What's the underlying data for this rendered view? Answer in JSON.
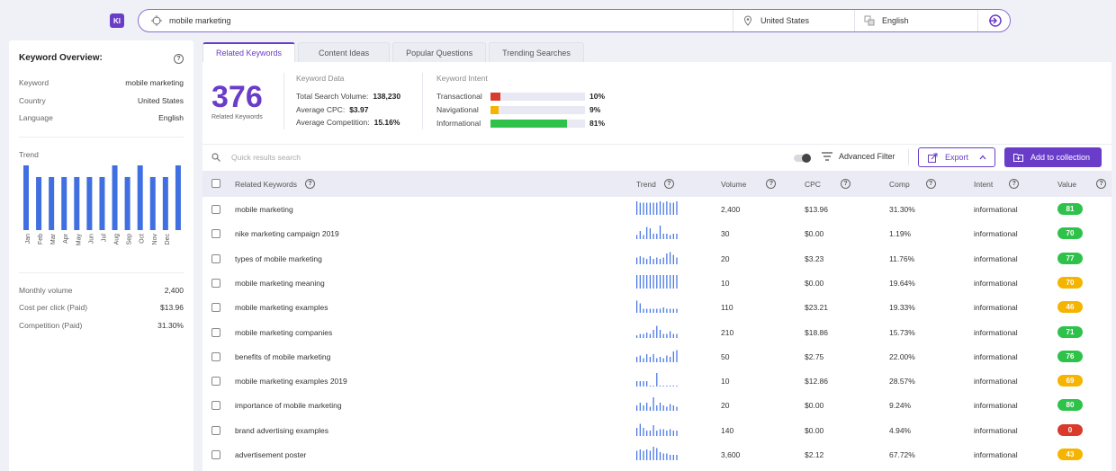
{
  "app": {
    "logo_text": "KI"
  },
  "search": {
    "query": "mobile marketing",
    "location": "United States",
    "language": "English",
    "icons": {
      "target": "crosshair-icon",
      "location": "map-pin-icon",
      "language": "translate-icon",
      "go": "login-arrow-icon"
    }
  },
  "overview": {
    "title": "Keyword Overview:",
    "rows": [
      {
        "label": "Keyword",
        "value": "mobile marketing"
      },
      {
        "label": "Country",
        "value": "United States"
      },
      {
        "label": "Language",
        "value": "English"
      }
    ],
    "trend_label": "Trend",
    "trend": {
      "months": [
        "Jan",
        "Feb",
        "Mar",
        "Apr",
        "May",
        "Jun",
        "Jul",
        "Aug",
        "Sep",
        "Oct",
        "Nov",
        "Dec"
      ],
      "values": [
        1.0,
        0.82,
        0.82,
        0.82,
        0.82,
        0.82,
        0.82,
        1.0,
        0.82,
        1.0,
        0.82,
        0.82,
        1.0
      ]
    },
    "stats": [
      {
        "label": "Monthly volume",
        "value": "2,400"
      },
      {
        "label": "Cost per click (Paid)",
        "value": "$13.96"
      },
      {
        "label": "Competition (Paid)",
        "value": "31.30%"
      }
    ]
  },
  "tabs": [
    {
      "label": "Related Keywords",
      "active": true
    },
    {
      "label": "Content Ideas",
      "active": false
    },
    {
      "label": "Popular Questions",
      "active": false
    },
    {
      "label": "Trending Searches",
      "active": false
    }
  ],
  "summary": {
    "count": "376",
    "count_label": "Related Keywords",
    "keyword_data_title": "Keyword Data",
    "keyword_data": [
      {
        "label": "Total Search Volume:",
        "value": "138,230"
      },
      {
        "label": "Average CPC:",
        "value": "$3.97"
      },
      {
        "label": "Average Competition:",
        "value": "15.16%"
      }
    ],
    "intent_title": "Keyword Intent",
    "intent": [
      {
        "label": "Transactional",
        "pct": "10%",
        "fraction": 0.1,
        "color": "#d93a2b"
      },
      {
        "label": "Navigational",
        "pct": "9%",
        "fraction": 0.09,
        "color": "#f5b400"
      },
      {
        "label": "Informational",
        "pct": "81%",
        "fraction": 0.81,
        "color": "#2fc24a"
      }
    ]
  },
  "toolbar": {
    "search_placeholder": "Quick results search",
    "advanced_filter": "Advanced Filter",
    "export": "Export",
    "add_collection": "Add to collection"
  },
  "table": {
    "headers": [
      "Related Keywords",
      "Trend",
      "Volume",
      "CPC",
      "Comp",
      "Intent",
      "Value"
    ],
    "rows": [
      {
        "keyword": "mobile marketing",
        "volume": "2,400",
        "cpc": "$13.96",
        "comp": "31.30%",
        "intent": "informational",
        "value": "81",
        "color": "#2fc24a",
        "trend": [
          10,
          9,
          9,
          9,
          9,
          9,
          9,
          10,
          9,
          10,
          9,
          9,
          10
        ]
      },
      {
        "keyword": "nike marketing campaign 2019",
        "volume": "30",
        "cpc": "$0.00",
        "comp": "1.19%",
        "intent": "informational",
        "value": "70",
        "color": "#2fc24a",
        "trend": [
          3,
          6,
          3,
          9,
          8,
          4,
          4,
          10,
          4,
          4,
          3,
          4,
          4
        ]
      },
      {
        "keyword": "types of mobile marketing",
        "volume": "20",
        "cpc": "$3.23",
        "comp": "11.76%",
        "intent": "informational",
        "value": "77",
        "color": "#2fc24a",
        "trend": [
          5,
          6,
          5,
          4,
          6,
          4,
          5,
          4,
          5,
          8,
          9,
          7,
          5
        ]
      },
      {
        "keyword": "mobile marketing meaning",
        "volume": "10",
        "cpc": "$0.00",
        "comp": "19.64%",
        "intent": "informational",
        "value": "70",
        "color": "#f5b400",
        "trend": [
          10,
          10,
          10,
          10,
          10,
          10,
          10,
          10,
          10,
          10,
          10,
          10,
          10
        ]
      },
      {
        "keyword": "mobile marketing examples",
        "volume": "110",
        "cpc": "$23.21",
        "comp": "19.33%",
        "intent": "informational",
        "value": "46",
        "color": "#f5b400",
        "trend": [
          9,
          7,
          3,
          3,
          3,
          3,
          3,
          3,
          4,
          3,
          3,
          3,
          3
        ]
      },
      {
        "keyword": "mobile marketing companies",
        "volume": "210",
        "cpc": "$18.86",
        "comp": "15.73%",
        "intent": "informational",
        "value": "71",
        "color": "#2fc24a",
        "trend": [
          2,
          3,
          3,
          4,
          3,
          6,
          9,
          6,
          3,
          3,
          5,
          3,
          3
        ]
      },
      {
        "keyword": "benefits of mobile marketing",
        "volume": "50",
        "cpc": "$2.75",
        "comp": "22.00%",
        "intent": "informational",
        "value": "76",
        "color": "#2fc24a",
        "trend": [
          4,
          5,
          3,
          6,
          4,
          6,
          3,
          4,
          3,
          5,
          4,
          8,
          9
        ]
      },
      {
        "keyword": "mobile marketing examples 2019",
        "volume": "10",
        "cpc": "$12.86",
        "comp": "28.57%",
        "intent": "informational",
        "value": "69",
        "color": "#f5b400",
        "trend": [
          4,
          4,
          4,
          4,
          0,
          0,
          10,
          0,
          0,
          0,
          0,
          0,
          0
        ]
      },
      {
        "keyword": "importance of mobile marketing",
        "volume": "20",
        "cpc": "$0.00",
        "comp": "9.24%",
        "intent": "informational",
        "value": "80",
        "color": "#2fc24a",
        "trend": [
          4,
          6,
          4,
          6,
          3,
          10,
          4,
          6,
          4,
          3,
          5,
          4,
          3
        ]
      },
      {
        "keyword": "brand advertising examples",
        "volume": "140",
        "cpc": "$0.00",
        "comp": "4.94%",
        "intent": "informational",
        "value": "0",
        "color": "#d93a2b",
        "trend": [
          6,
          9,
          6,
          4,
          4,
          8,
          4,
          5,
          5,
          4,
          5,
          4,
          4
        ]
      },
      {
        "keyword": "advertisement poster",
        "volume": "3,600",
        "cpc": "$2.12",
        "comp": "67.72%",
        "intent": "informational",
        "value": "43",
        "color": "#f5b400",
        "trend": [
          7,
          8,
          7,
          8,
          7,
          10,
          9,
          6,
          5,
          5,
          4,
          4,
          4
        ]
      }
    ]
  }
}
